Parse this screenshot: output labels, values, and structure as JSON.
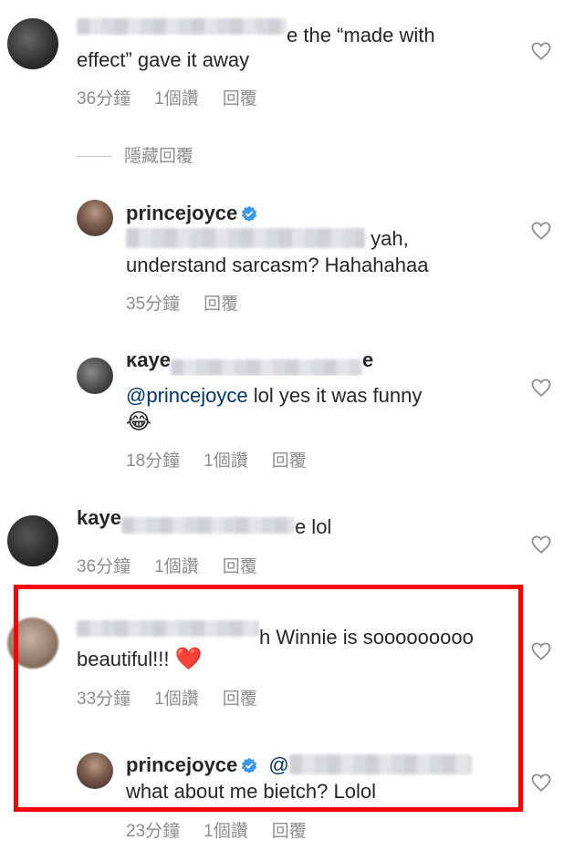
{
  "comments": [
    {
      "text_line1": "e the “made with",
      "text_line2": "effect” gave it away",
      "time": "36分鐘",
      "likes": "1個讚",
      "reply": "回覆"
    },
    {
      "hidden_replies": "隱藏回覆"
    },
    {
      "username": "princejoyce",
      "text_line1": "yah,",
      "text_line2": "understand sarcasm? Hahahahaa",
      "time": "35分鐘",
      "reply": "回覆"
    },
    {
      "username_partial": "kaye",
      "username_tail": "e",
      "mention": "@princejoyce",
      "text_line1": " lol yes it was funny",
      "emoji": "😂",
      "time": "18分鐘",
      "likes": "1個讚",
      "reply": "回覆"
    },
    {
      "username_partial": "kaye",
      "text_tail": "e lol",
      "time": "36分鐘",
      "likes": "1個讚",
      "reply": "回覆"
    },
    {
      "text_line1": "h Winnie is sooooooooo",
      "text_line2": "beautiful!!!",
      "emoji": "❤️",
      "time": "33分鐘",
      "likes": "1個讚",
      "reply": "回覆"
    },
    {
      "username": "princejoyce",
      "mention": "@",
      "text_line2": "what about me bietch? Lolol",
      "time": "23分鐘",
      "likes": "1個讚",
      "reply": "回覆"
    }
  ],
  "colors": {
    "text": "#262626",
    "meta": "#8e8e8e",
    "mention": "#00376b",
    "verified": "#3897f0",
    "highlight": "#ff0000"
  },
  "icons": {
    "like": "heart-outline-icon",
    "verified": "verified-badge-icon"
  }
}
